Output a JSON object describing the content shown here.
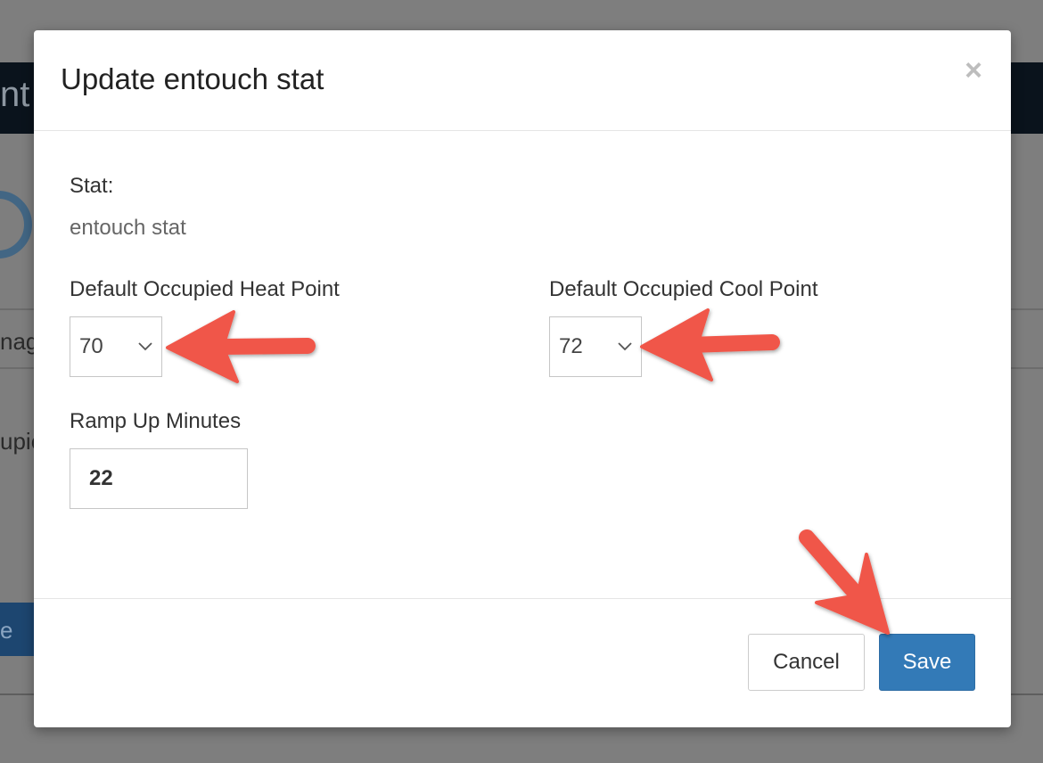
{
  "background": {
    "header_fragment": "nt",
    "text_fragment_1": "nag",
    "text_fragment_2": "upie",
    "button_fragment": "e"
  },
  "modal": {
    "title": "Update entouch stat",
    "close_symbol": "×",
    "stat_label": "Stat:",
    "stat_value": "entouch stat",
    "heat_label": "Default Occupied Heat Point",
    "heat_value": "70",
    "cool_label": "Default Occupied Cool Point",
    "cool_value": "72",
    "ramp_label": "Ramp Up Minutes",
    "ramp_value": "22",
    "cancel_label": "Cancel",
    "save_label": "Save"
  },
  "colors": {
    "primary": "#337ab7",
    "annotation_arrow": "#f0574a"
  },
  "icons": [
    "close-icon",
    "chevron-down-icon",
    "annotation-arrow"
  ]
}
